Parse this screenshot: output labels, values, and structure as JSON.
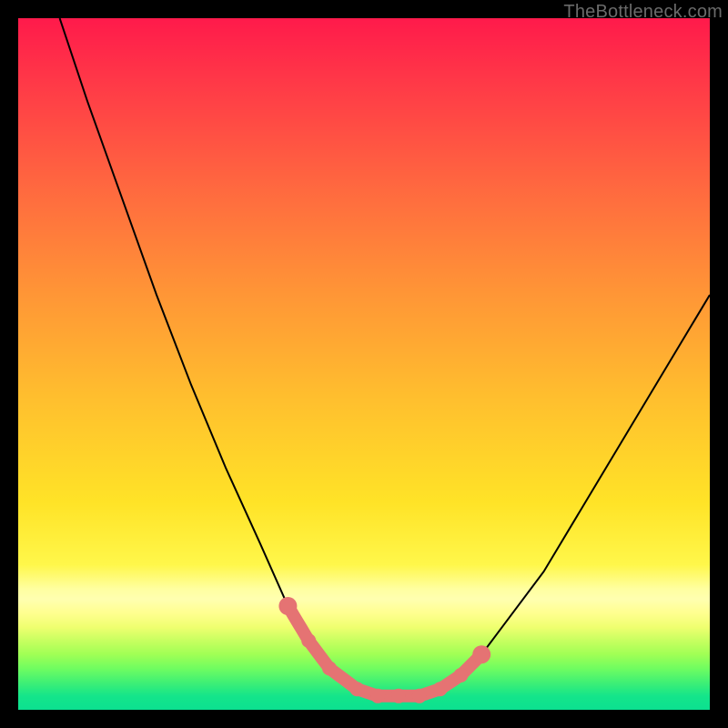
{
  "watermark": "TheBottleneck.com",
  "chart_data": {
    "type": "line",
    "title": "",
    "xlabel": "",
    "ylabel": "",
    "xlim": [
      0,
      100
    ],
    "ylim": [
      0,
      100
    ],
    "series": [
      {
        "name": "bottleneck-curve",
        "x": [
          6,
          10,
          15,
          20,
          25,
          30,
          35,
          39,
          42,
          45,
          49,
          52,
          55,
          58,
          61,
          64,
          67,
          70,
          76,
          82,
          88,
          94,
          100
        ],
        "values": [
          100,
          88,
          74,
          60,
          47,
          35,
          24,
          15,
          10,
          6,
          3,
          2,
          2,
          2,
          3,
          5,
          8,
          12,
          20,
          30,
          40,
          50,
          60
        ]
      }
    ],
    "annotations": {
      "marker_points_x": [
        39,
        42,
        45,
        49,
        52,
        55,
        58,
        61,
        64,
        67
      ],
      "marker_color": "#e57373"
    },
    "background_gradient": {
      "top": "#ff1a4b",
      "mid": "#ffe327",
      "bottom": "#0ce090"
    }
  }
}
